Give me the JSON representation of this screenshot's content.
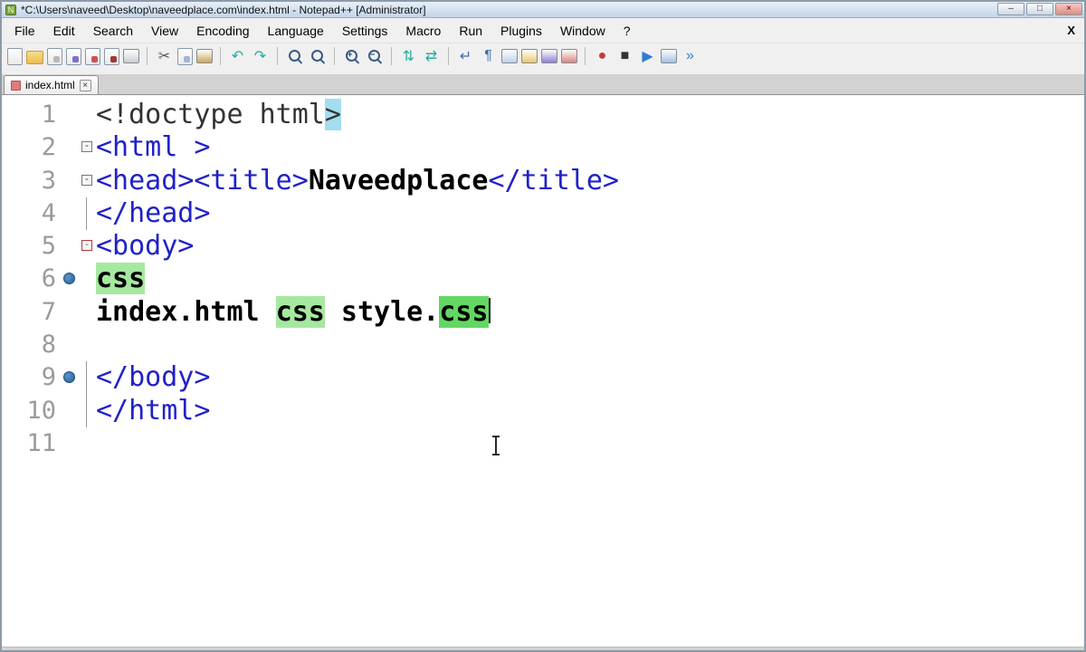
{
  "window": {
    "title": "*C:\\Users\\naveed\\Desktop\\naveedplace.com\\index.html - Notepad++ [Administrator]",
    "controls": {
      "minimize": "–",
      "maximize": "□",
      "close": "×"
    }
  },
  "menu": {
    "items": [
      "File",
      "Edit",
      "Search",
      "View",
      "Encoding",
      "Language",
      "Settings",
      "Macro",
      "Run",
      "Plugins",
      "Window",
      "?"
    ],
    "close_label": "X"
  },
  "toolbar": {
    "icons": [
      {
        "name": "new-file",
        "kind": "page"
      },
      {
        "name": "open-folder",
        "kind": "folder"
      },
      {
        "name": "save",
        "kind": "page",
        "accent": "#b9b9b9"
      },
      {
        "name": "save-all",
        "kind": "page",
        "accent": "#7d6fd0"
      },
      {
        "name": "close",
        "kind": "page",
        "accent": "#d05050"
      },
      {
        "name": "close-all",
        "kind": "page",
        "accent": "#a03838"
      },
      {
        "name": "print",
        "kind": "swatch",
        "color": "#c8cdd4"
      },
      {
        "sep": true
      },
      {
        "name": "cut",
        "kind": "glyph",
        "ch": "✂",
        "color": "#555555"
      },
      {
        "name": "copy",
        "kind": "page",
        "accent": "#9fb6d8"
      },
      {
        "name": "paste",
        "kind": "swatch",
        "color": "#c9a75a"
      },
      {
        "sep": true
      },
      {
        "name": "undo",
        "kind": "glyph",
        "ch": "↶",
        "color": "#2aa9a0"
      },
      {
        "name": "redo",
        "kind": "glyph",
        "ch": "↷",
        "color": "#2aa9a0"
      },
      {
        "sep": true
      },
      {
        "name": "find",
        "kind": "lens"
      },
      {
        "name": "replace",
        "kind": "lens"
      },
      {
        "sep": true
      },
      {
        "name": "zoom-in",
        "kind": "lens",
        "ch": "+"
      },
      {
        "name": "zoom-out",
        "kind": "lens",
        "ch": "−"
      },
      {
        "sep": true
      },
      {
        "name": "sync-vertical-scroll",
        "kind": "glyph",
        "ch": "⇅",
        "color": "#2aa9a0"
      },
      {
        "name": "sync-horizontal-scroll",
        "kind": "glyph",
        "ch": "⇄",
        "color": "#2aa9a0"
      },
      {
        "sep": true
      },
      {
        "name": "word-wrap",
        "kind": "glyph",
        "ch": "↵",
        "color": "#3a6fb0"
      },
      {
        "name": "show-all-characters",
        "kind": "glyph",
        "ch": "¶",
        "color": "#3a6fb0"
      },
      {
        "name": "indent-guide",
        "kind": "swatch",
        "color": "#bcd2ee"
      },
      {
        "name": "document-map",
        "kind": "swatch",
        "color": "#e8c96a"
      },
      {
        "name": "function-list",
        "kind": "swatch",
        "color": "#8f7fd6"
      },
      {
        "name": "file-monitoring",
        "kind": "swatch",
        "color": "#d98484"
      },
      {
        "sep": true
      },
      {
        "name": "macro-record",
        "kind": "glyph",
        "ch": "●",
        "color": "#c43c3c"
      },
      {
        "name": "macro-stop",
        "kind": "glyph",
        "ch": "■",
        "color": "#333333"
      },
      {
        "name": "macro-play",
        "kind": "glyph",
        "ch": "▶",
        "color": "#2e7fd0"
      },
      {
        "name": "macro-save",
        "kind": "swatch",
        "color": "#9fc2e8"
      },
      {
        "name": "macro-run-multiple",
        "kind": "glyph",
        "ch": "»",
        "color": "#2e7fd0"
      }
    ]
  },
  "tabbar": {
    "tabs": [
      {
        "label": "index.html",
        "close_glyph": "×"
      }
    ]
  },
  "editor": {
    "lines": [
      {
        "num": "1",
        "segs": [
          {
            "t": "<!doctype html",
            "c": "doctype"
          },
          {
            "t": ">",
            "c": "doctype hl-blue"
          }
        ]
      },
      {
        "num": "2",
        "fold": "box",
        "segs": [
          {
            "t": "<html >",
            "c": "tag"
          }
        ]
      },
      {
        "num": "3",
        "fold": "box",
        "segs": [
          {
            "t": "<head><title>",
            "c": "tag"
          },
          {
            "t": "Naveedplace",
            "c": "bold"
          },
          {
            "t": "</title>",
            "c": "tag"
          }
        ]
      },
      {
        "num": "4",
        "fold": "line",
        "segs": [
          {
            "t": "</head>",
            "c": "tag"
          }
        ]
      },
      {
        "num": "5",
        "fold": "box-red",
        "segs": [
          {
            "t": "<body>",
            "c": "tag"
          }
        ]
      },
      {
        "num": "6",
        "mark": "bookmark",
        "segs": [
          {
            "t": "css",
            "c": "bold hl-green"
          }
        ]
      },
      {
        "num": "7",
        "caret": true,
        "segs": [
          {
            "t": "index.html ",
            "c": "bold"
          },
          {
            "t": "css",
            "c": "bold hl-green"
          },
          {
            "t": " style.",
            "c": "bold"
          },
          {
            "t": "css",
            "c": "bold hl-green-sel"
          }
        ]
      },
      {
        "num": "8",
        "segs": []
      },
      {
        "num": "9",
        "mark": "bookmark",
        "fold": "line",
        "segs": [
          {
            "t": "</body>",
            "c": "tag"
          }
        ]
      },
      {
        "num": "10",
        "fold": "line",
        "segs": [
          {
            "t": "</html>",
            "c": "tag"
          }
        ]
      },
      {
        "num": "11",
        "segs": []
      }
    ]
  }
}
